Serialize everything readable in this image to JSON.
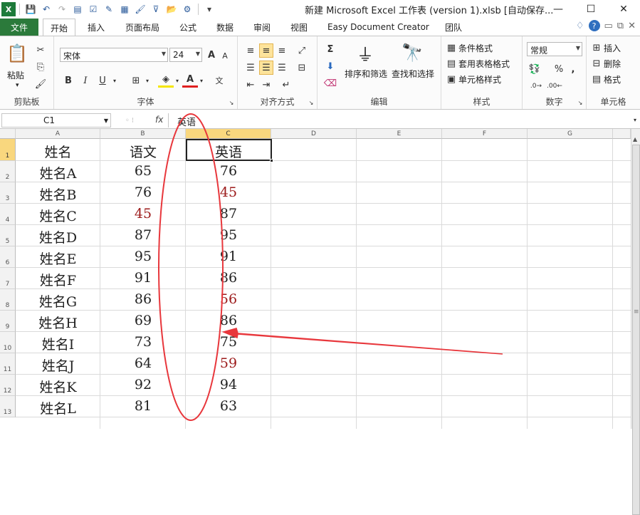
{
  "titlebar": {
    "title": "新建 Microsoft Excel 工作表 (version 1).xlsb [自动保存...",
    "minimize": "—",
    "maximize": "☐",
    "close": "✕"
  },
  "tabs": {
    "file": "文件",
    "items": [
      "开始",
      "插入",
      "页面布局",
      "公式",
      "数据",
      "审阅",
      "视图",
      "Easy Document Creator",
      "团队"
    ]
  },
  "ribbon": {
    "clipboard": {
      "paste": "粘贴",
      "label": "剪贴板"
    },
    "font": {
      "name": "宋体",
      "size": "24",
      "grow": "A",
      "shrink": "A",
      "bold": "B",
      "italic": "I",
      "underline": "U",
      "label": "字体"
    },
    "alignment": {
      "label": "对齐方式"
    },
    "editing": {
      "sort_filter": "排序和筛选",
      "find_select": "查找和选择",
      "label": "编辑"
    },
    "styles": {
      "conditional": "条件格式",
      "table_format": "套用表格格式",
      "cell_style": "单元格样式",
      "label": "样式"
    },
    "number": {
      "format": "常规",
      "percent": "%",
      "comma": ",",
      "label": "数字"
    },
    "cells": {
      "insert": "插入",
      "delete": "删除",
      "format": "格式",
      "label": "单元格"
    }
  },
  "formula_bar": {
    "name_box": "C1",
    "fx": "fx",
    "content": "英语"
  },
  "sheet": {
    "columns": [
      "A",
      "B",
      "C",
      "D",
      "E",
      "F",
      "G"
    ],
    "rows": [
      "1",
      "2",
      "3",
      "4",
      "5",
      "6",
      "7",
      "8",
      "9",
      "10",
      "11",
      "12",
      "13"
    ],
    "header": [
      "姓名",
      "语文",
      "英语"
    ],
    "data": [
      [
        "姓名A",
        "65",
        "76"
      ],
      [
        "姓名B",
        "76",
        "45"
      ],
      [
        "姓名C",
        "45",
        "87"
      ],
      [
        "姓名D",
        "87",
        "95"
      ],
      [
        "姓名E",
        "95",
        "91"
      ],
      [
        "姓名F",
        "91",
        "86"
      ],
      [
        "姓名G",
        "86",
        "56"
      ],
      [
        "姓名H",
        "69",
        "86"
      ],
      [
        "姓名I",
        "73",
        "75"
      ],
      [
        "姓名J",
        "64",
        "59"
      ],
      [
        "姓名K",
        "92",
        "94"
      ],
      [
        "姓名L",
        "81",
        "63"
      ]
    ],
    "red_color": "#9c1b1b"
  },
  "annotation_color": "#e8373c"
}
